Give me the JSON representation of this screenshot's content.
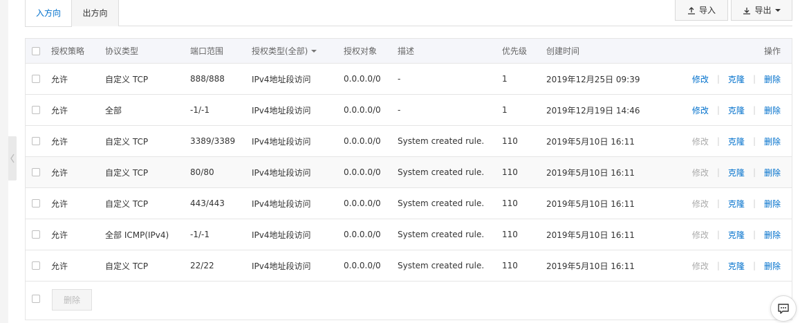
{
  "tabs": [
    {
      "label": "入方向",
      "active": true
    },
    {
      "label": "出方向",
      "active": false
    }
  ],
  "toolbar": {
    "import_label": "导入",
    "export_label": "导出"
  },
  "table": {
    "headers": {
      "policy": "授权策略",
      "protocol": "协议类型",
      "port": "端口范围",
      "auth_type": "授权类型(全部)",
      "auth_target": "授权对象",
      "desc": "描述",
      "priority": "优先级",
      "created": "创建时间",
      "actions": "操作"
    },
    "actions": {
      "edit": "修改",
      "clone": "克隆",
      "delete": "删除"
    },
    "rows": [
      {
        "policy": "允许",
        "protocol": "自定义 TCP",
        "port": "888/888",
        "auth_type": "IPv4地址段访问",
        "target": "0.0.0.0/0",
        "desc": "-",
        "priority": "1",
        "created": "2019年12月25日 09:39",
        "edit_enabled": true
      },
      {
        "policy": "允许",
        "protocol": "全部",
        "port": "-1/-1",
        "auth_type": "IPv4地址段访问",
        "target": "0.0.0.0/0",
        "desc": "-",
        "priority": "1",
        "created": "2019年12月19日 14:46",
        "edit_enabled": true
      },
      {
        "policy": "允许",
        "protocol": "自定义 TCP",
        "port": "3389/3389",
        "auth_type": "IPv4地址段访问",
        "target": "0.0.0.0/0",
        "desc": "System created rule.",
        "priority": "110",
        "created": "2019年5月10日 16:11",
        "edit_enabled": false
      },
      {
        "policy": "允许",
        "protocol": "自定义 TCP",
        "port": "80/80",
        "auth_type": "IPv4地址段访问",
        "target": "0.0.0.0/0",
        "desc": "System created rule.",
        "priority": "110",
        "created": "2019年5月10日 16:11",
        "edit_enabled": false
      },
      {
        "policy": "允许",
        "protocol": "自定义 TCP",
        "port": "443/443",
        "auth_type": "IPv4地址段访问",
        "target": "0.0.0.0/0",
        "desc": "System created rule.",
        "priority": "110",
        "created": "2019年5月10日 16:11",
        "edit_enabled": false
      },
      {
        "policy": "允许",
        "protocol": "全部 ICMP(IPv4)",
        "port": "-1/-1",
        "auth_type": "IPv4地址段访问",
        "target": "0.0.0.0/0",
        "desc": "System created rule.",
        "priority": "110",
        "created": "2019年5月10日 16:11",
        "edit_enabled": false
      },
      {
        "policy": "允许",
        "protocol": "自定义 TCP",
        "port": "22/22",
        "auth_type": "IPv4地址段访问",
        "target": "0.0.0.0/0",
        "desc": "System created rule.",
        "priority": "110",
        "created": "2019年5月10日 16:11",
        "edit_enabled": false
      }
    ]
  },
  "footer": {
    "bulk_delete_label": "删除"
  },
  "colors": {
    "link": "#0070cc",
    "disabled": "#aaaaaa",
    "border": "#e5e5e5"
  }
}
